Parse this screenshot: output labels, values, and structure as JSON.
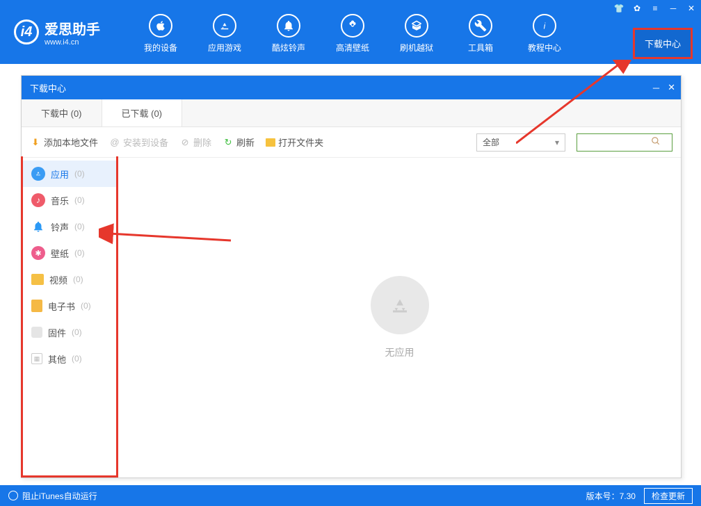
{
  "header": {
    "logo_title": "爱思助手",
    "logo_sub": "www.i4.cn",
    "nav": [
      {
        "label": "我的设备"
      },
      {
        "label": "应用游戏"
      },
      {
        "label": "酷炫铃声"
      },
      {
        "label": "高清壁纸"
      },
      {
        "label": "刷机越狱"
      },
      {
        "label": "工具箱"
      },
      {
        "label": "教程中心"
      }
    ],
    "download_center": "下载中心"
  },
  "panel": {
    "title": "下载中心",
    "tabs": [
      {
        "label": "下载中 (0)"
      },
      {
        "label": "已下载 (0)"
      }
    ],
    "toolbar": {
      "add_local": "添加本地文件",
      "install": "安装到设备",
      "delete": "删除",
      "refresh": "刷新",
      "open_folder": "打开文件夹",
      "filter": "全部"
    },
    "sidebar": [
      {
        "label": "应用",
        "count": "(0)",
        "color": "#3a9cf4"
      },
      {
        "label": "音乐",
        "count": "(0)",
        "color": "#ef5b6a"
      },
      {
        "label": "铃声",
        "count": "(0)",
        "color": "#2b99f6"
      },
      {
        "label": "壁纸",
        "count": "(0)",
        "color": "#ee5d8c"
      },
      {
        "label": "视频",
        "count": "(0)",
        "color": "#f5c045"
      },
      {
        "label": "电子书",
        "count": "(0)",
        "color": "#f5b945"
      },
      {
        "label": "固件",
        "count": "(0)",
        "color": "#d0d0d0"
      },
      {
        "label": "其他",
        "count": "(0)",
        "color": "#c0c0c0"
      }
    ],
    "empty_text": "无应用"
  },
  "footer": {
    "itunes": "阻止iTunes自动运行",
    "version": "版本号：7.30",
    "update": "检查更新"
  }
}
